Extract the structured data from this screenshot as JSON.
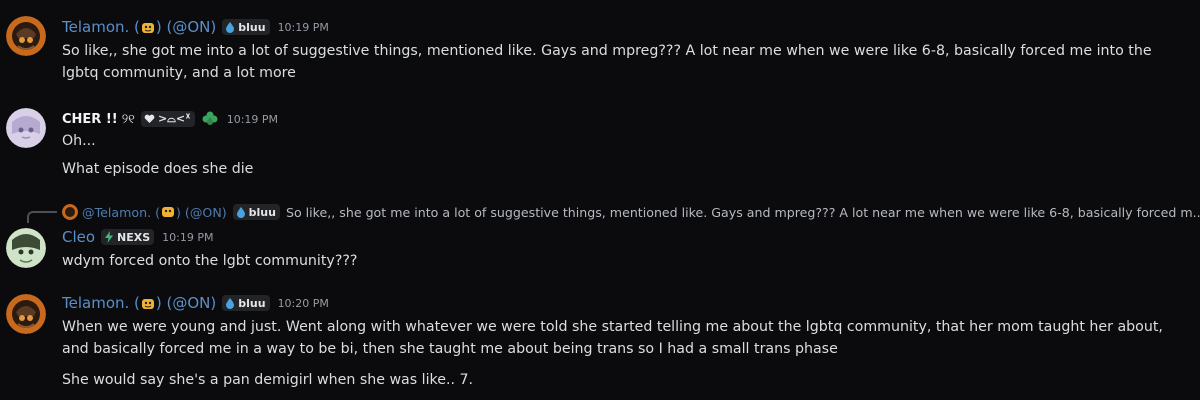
{
  "messages": [
    {
      "username": "Telamon. (",
      "username_suffix": ") (@ON)",
      "tag": "bluu",
      "timestamp": "10:19 PM",
      "lines": [
        "So like,, she got me into a lot of suggestive things, mentioned like. Gays and mpreg??? A lot near me when we were like 6-8, basically forced me into the lgbtq community, and a lot more"
      ]
    },
    {
      "username": "CHER !!",
      "name_decor": "୨୧",
      "tag": ">⌓<ᕁ",
      "timestamp": "10:19 PM",
      "lines": [
        "Oh...",
        "What episode does she die"
      ]
    },
    {
      "reply": {
        "username": "@Telamon. (",
        "username_suffix": ") (@ON)",
        "tag": "bluu",
        "text": "So like,, she got me into a lot of suggestive things, mentioned like. Gays and mpreg??? A lot near me when we were like 6-8, basically forced m..."
      },
      "username": "Cleo",
      "tag": "NEXS",
      "timestamp": "10:19 PM",
      "lines": [
        "wdym forced onto the lgbt community???"
      ]
    },
    {
      "username": "Telamon. (",
      "username_suffix": ") (@ON)",
      "tag": "bluu",
      "timestamp": "10:20 PM",
      "lines": [
        "When we were young and just. Went along with whatever we were told she started telling me about the lgbtq community, that her mom taught her about, and basically forced me in a way to be bi, then she taught me about being trans so I had a small trans phase",
        "She would say she's a pan demigirl when she was like.. 7."
      ]
    }
  ],
  "colors": {
    "background": "#0b0b0d",
    "username_blue": "#5b8fc9",
    "text": "#dbdee1",
    "timestamp": "#949ba4",
    "tag_bg": "#232428"
  },
  "icons": [
    "helmet-avatar",
    "anime-avatar",
    "green-avatar",
    "theater-mask-icon",
    "water-drop-icon",
    "heart-icon",
    "clover-icon",
    "lightning-icon"
  ]
}
